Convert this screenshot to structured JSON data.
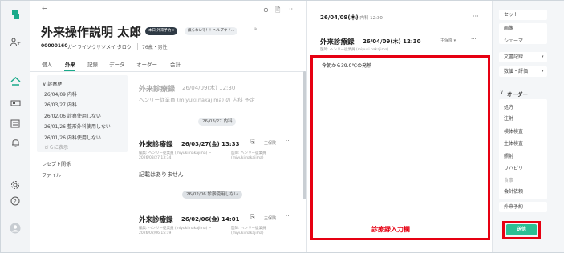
{
  "nav": {
    "icons": [
      "app-logo-icon",
      "users-icon",
      "home-icon",
      "bed-icon",
      "list-icon",
      "bell-icon",
      "settings-icon",
      "help-icon",
      "user-avatar-icon"
    ]
  },
  "header": {
    "back": "←",
    "patient_name": "外来操作説明 太郎",
    "badge_visit": "本日 外来予約 ▾",
    "badge_note": "無らないで！！ヘルプサイ…",
    "badge_extra": "⊕",
    "patient_id": "00000160",
    "kana": "ガイライソウサツメイ タロウ",
    "age_sex": "76歳・男性",
    "header_icon1": "⊙",
    "header_icon2": "🖹",
    "more": "···"
  },
  "tabs": [
    "個人",
    "外来",
    "記録",
    "データ",
    "オーダー",
    "会計"
  ],
  "active_tab": 1,
  "history": {
    "title": "診察歴",
    "items": [
      "26/04/09 内科",
      "26/03/27 内科",
      "26/02/06 診察使用しない",
      "26/01/26 整形外科使用しない",
      "26/01/26 内科使用しない"
    ],
    "more": "さらに表示",
    "other": [
      "レセプト関係",
      "ファイル"
    ]
  },
  "records": [
    {
      "title": "外来診療録",
      "date": "26/04/09(木) 12:30",
      "sub": "ヘンリー従業員 (miyuki.nakajima) の 内科 予定",
      "faded": true
    },
    {
      "divider": "26/03/27 内科",
      "title": "外来診療録",
      "date": "26/03/27(金) 13:33",
      "insurance": "主保険",
      "editor": "編集: ヘンリー従業員 (miyuki.nakajima) ・",
      "edited_at": "2026/03/27 13:34",
      "doctor": "医師: ヘンリー従業員",
      "doctor_id": "(miyuki.nakajima)",
      "content": "記載はありません"
    },
    {
      "divider": "26/02/06 診察使用しない",
      "title": "外来診療録",
      "date": "26/02/06(金) 14:01",
      "insurance": "主保険",
      "editor": "編集: ヘンリー従業員 (miyuki.nakajima) ・",
      "edited_at": "2026/02/06 15:19",
      "doctor": "医師: ヘンリー従業員",
      "doctor_id": "(miyuki.nakajima)"
    }
  ],
  "editor": {
    "top_date": "26/04/09(木)",
    "top_dept": "∞ 内科 12:30",
    "more": "···",
    "title": "外来診療録",
    "date": "26/04/09(木) 12:30",
    "insurance": "主保険 ▾",
    "doctor": "医師: ヘンリー従業員 (miyuki.nakajima)",
    "text": "今朝から39.0℃の発熱",
    "annotation": "診療録入力欄"
  },
  "right_panel": {
    "items": [
      "セット",
      "画像",
      "シェーマ",
      "文書記録",
      "数値・評価"
    ],
    "order_header": "オーダー",
    "orders": [
      "処方",
      "注射",
      "検体検査",
      "生体検査",
      "照射",
      "リハビリ",
      "食事",
      "会計依頼"
    ],
    "reserve": "外来予約",
    "send": "送信"
  },
  "colors": {
    "accent": "#1aaa8a",
    "highlight": "#e60012",
    "annotation": "#e60012"
  }
}
